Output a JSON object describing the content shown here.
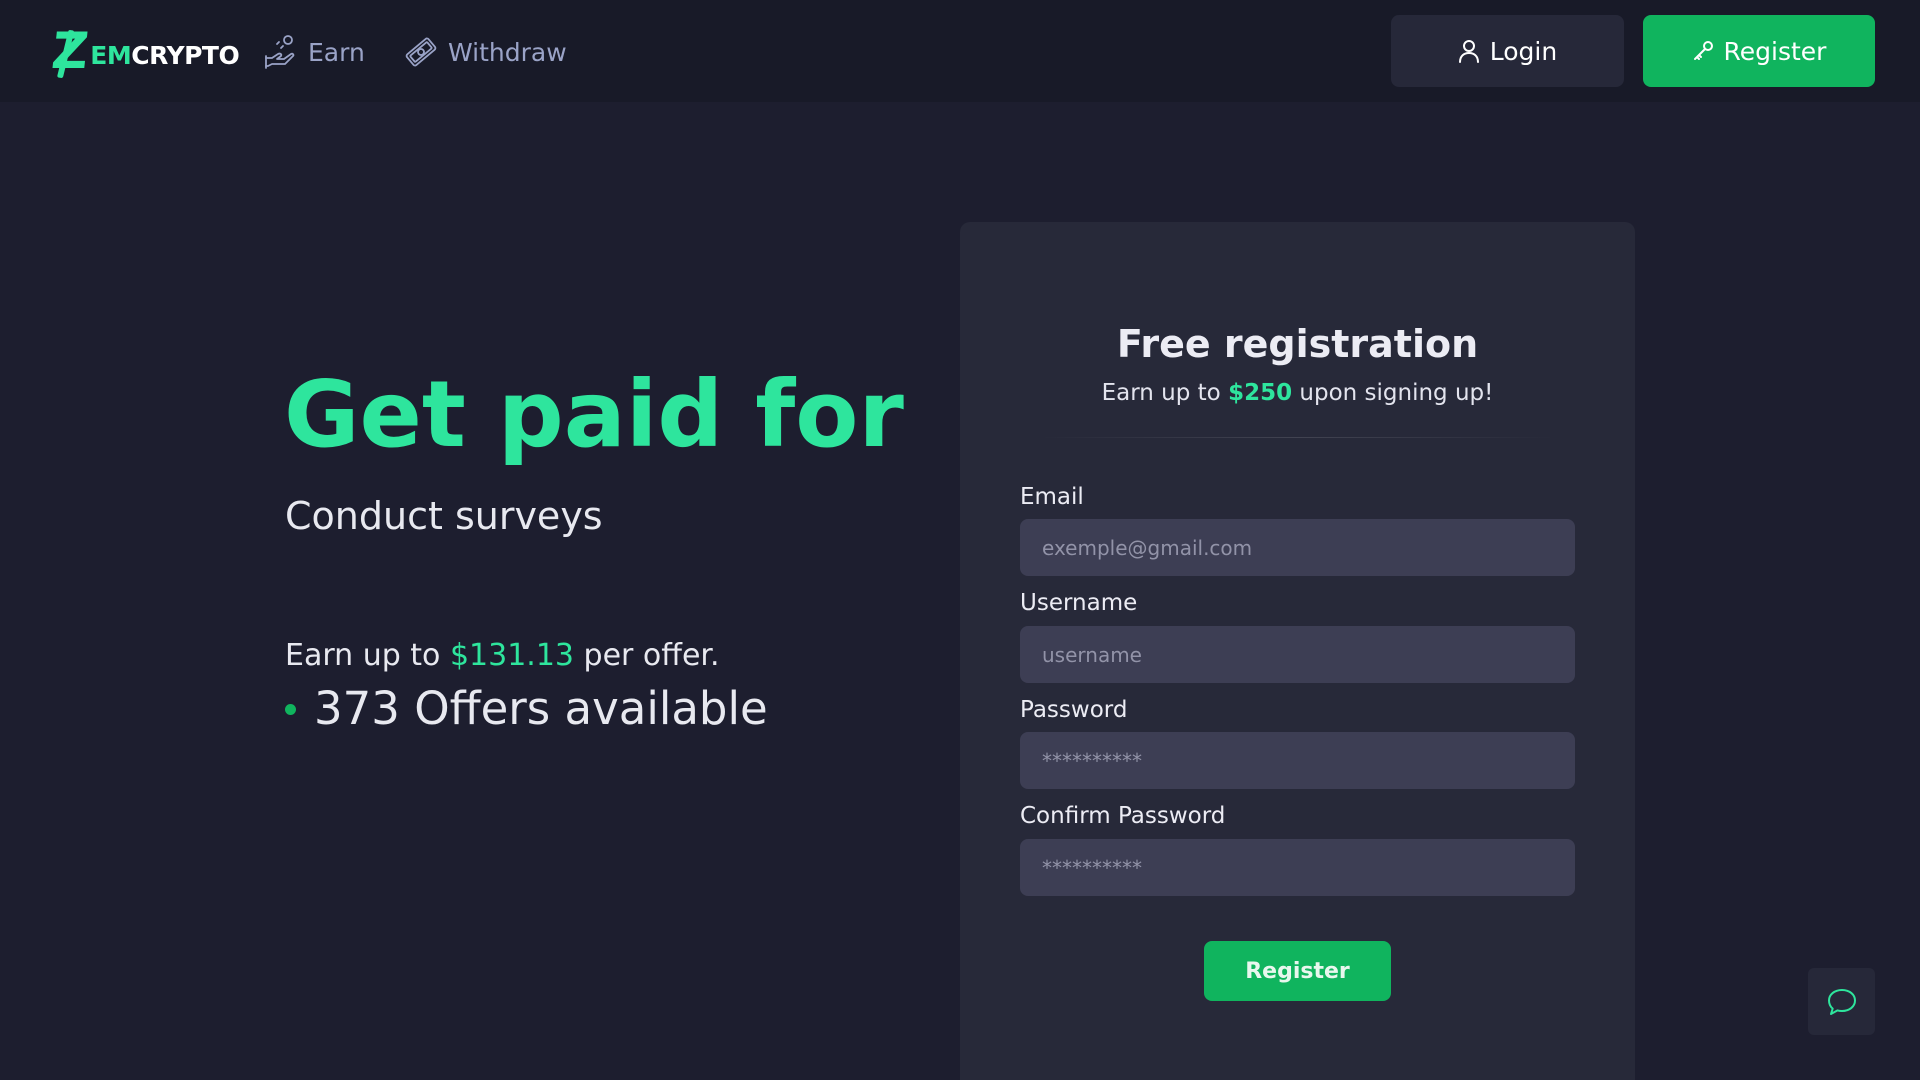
{
  "brand": {
    "logo_z": "Z",
    "logo_em": "EM",
    "logo_crypto": "CRYPTO",
    "accent_color": "#2ee59d",
    "button_color": "#10b45e"
  },
  "nav": {
    "earn": {
      "label": "Earn",
      "icon": "hand-coin-icon"
    },
    "withdraw": {
      "label": "Withdraw",
      "icon": "money-bill-icon"
    },
    "login": {
      "label": "Login",
      "icon": "user-icon"
    },
    "register": {
      "label": "Register",
      "icon": "key-icon"
    }
  },
  "hero": {
    "title": "Get paid for",
    "subtitle": "Conduct surveys",
    "earn_prefix": "Earn up to ",
    "earn_amount": "$131.13",
    "earn_suffix": " per offer.",
    "offers_text": "373 Offers available"
  },
  "registration": {
    "title": "Free registration",
    "sub_prefix": "Earn up to ",
    "sub_amount": "$250",
    "sub_suffix": " upon signing up!",
    "fields": {
      "email": {
        "label": "Email",
        "placeholder": "exemple@gmail.com",
        "value": ""
      },
      "username": {
        "label": "Username",
        "placeholder": "username",
        "value": ""
      },
      "password": {
        "label": "Password",
        "placeholder": "**********",
        "value": ""
      },
      "confirm_password": {
        "label": "Confirm Password",
        "placeholder": "**********",
        "value": ""
      }
    },
    "submit_label": "Register"
  },
  "chat": {
    "icon": "chat-bubble-icon"
  }
}
